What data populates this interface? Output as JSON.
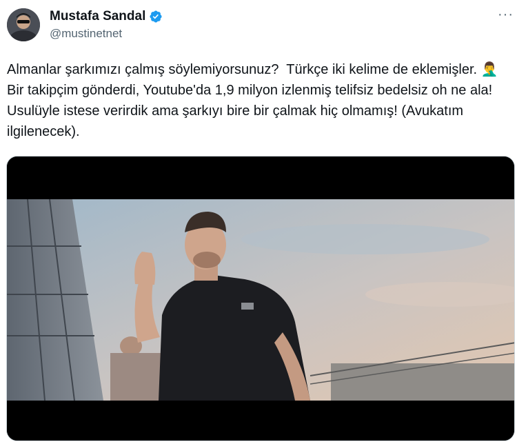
{
  "author": {
    "display_name": "Mustafa Sandal",
    "handle": "@mustinetnet",
    "verified": true
  },
  "tweet": {
    "text": "Almanlar şarkımızı çalmış söylemiyorsunuz?  Türkçe iki kelime de eklemişler. 🤦‍♂️ Bir takipçim gönderdi, Youtube'da 1,9 milyon izlenmiş telifsiz bedelsiz oh ne ala! Usulüyle istese verirdik ama şarkıyı bire bir çalmak hiç olmamış! (Avukatım ilgilenecek)."
  },
  "icons": {
    "avatar": "profile-avatar",
    "verified": "verified-badge-icon",
    "more": "more-options-icon"
  },
  "colors": {
    "accent": "#1d9bf0",
    "text": "#0f1419",
    "secondary": "#536471"
  }
}
